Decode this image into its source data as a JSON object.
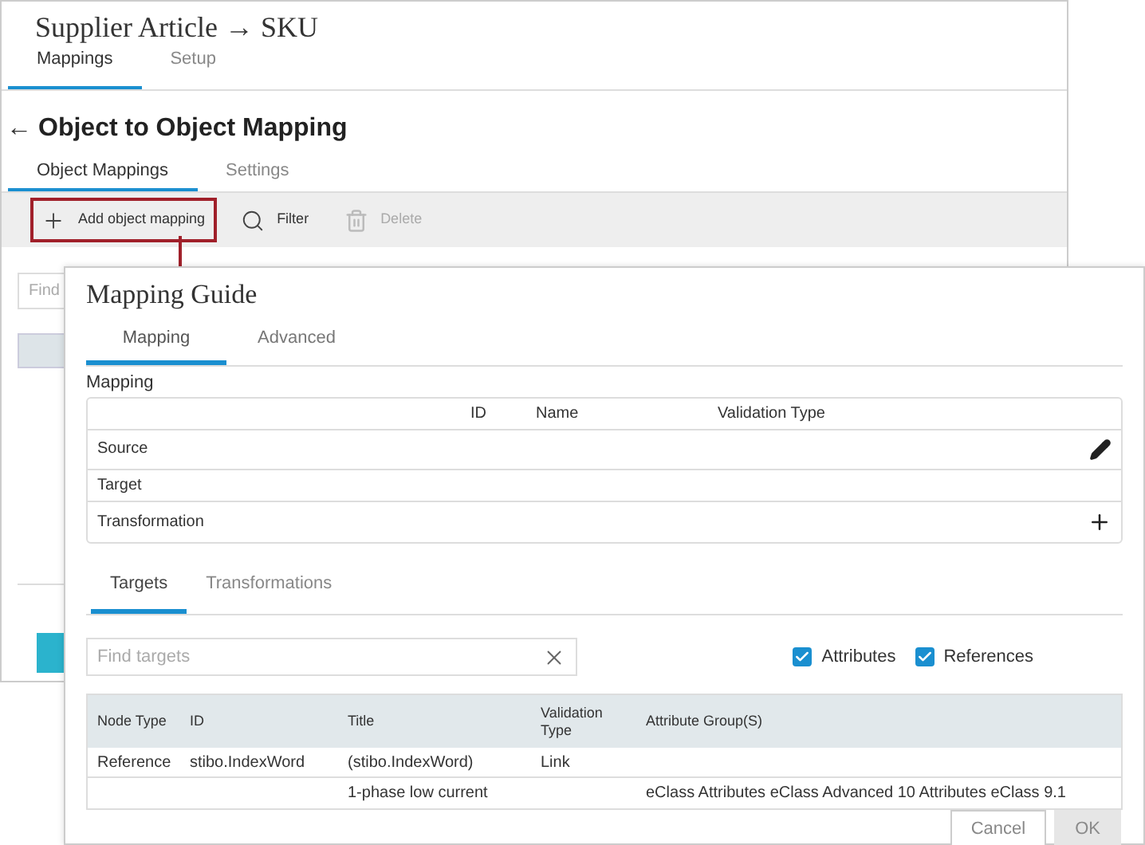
{
  "window": {
    "title": "Supplier Article → SKU",
    "tabs": [
      {
        "label": "Mappings",
        "selected": true
      },
      {
        "label": "Setup",
        "selected": false
      }
    ]
  },
  "page": {
    "back_icon": "←",
    "title": "Object to Object Mapping",
    "tabs": [
      {
        "label": "Object Mappings",
        "selected": true
      },
      {
        "label": "Settings",
        "selected": false
      }
    ],
    "toolbar": [
      {
        "label": "Add object mapping",
        "highlighted": true,
        "disabled": false
      },
      {
        "label": "Filter",
        "highlighted": false,
        "disabled": false
      },
      {
        "label": "Delete",
        "highlighted": false,
        "disabled": true
      }
    ],
    "search": {
      "placeholder": "Find"
    }
  },
  "dialog": {
    "title": "Mapping Guide",
    "tabs": [
      {
        "label": "Mapping",
        "selected": true
      },
      {
        "label": "Advanced",
        "selected": false
      }
    ],
    "mapping": {
      "label": "Mapping",
      "columns": [
        "ID",
        "Name",
        "Validation Type"
      ],
      "rows": [
        {
          "label": "Source",
          "kind": "editable"
        },
        {
          "label": "Target",
          "kind": "plain"
        },
        {
          "label": "Transformation",
          "kind": "addable"
        }
      ]
    },
    "subtabs": [
      {
        "label": "Targets",
        "selected": true
      },
      {
        "label": "Transformations",
        "selected": false
      }
    ],
    "search": {
      "placeholder": "Find targets"
    },
    "filters": [
      {
        "label": "Attributes",
        "checked": true
      },
      {
        "label": "References",
        "checked": true
      }
    ],
    "table": {
      "columns": [
        "Node Type",
        "ID",
        "Title",
        "Validation Type",
        "Attribute Group(S)"
      ],
      "rows": [
        [
          "Reference",
          "stibo.IndexWord",
          "(stibo.IndexWord)",
          "Link",
          ""
        ],
        [
          "",
          "",
          "1-phase low current",
          "",
          "eClass Attributes eClass Advanced 10 Attributes eClass 9.1"
        ]
      ]
    },
    "buttons": [
      {
        "label": "Cancel",
        "disabled": false
      },
      {
        "label": "OK",
        "disabled": true
      }
    ]
  }
}
